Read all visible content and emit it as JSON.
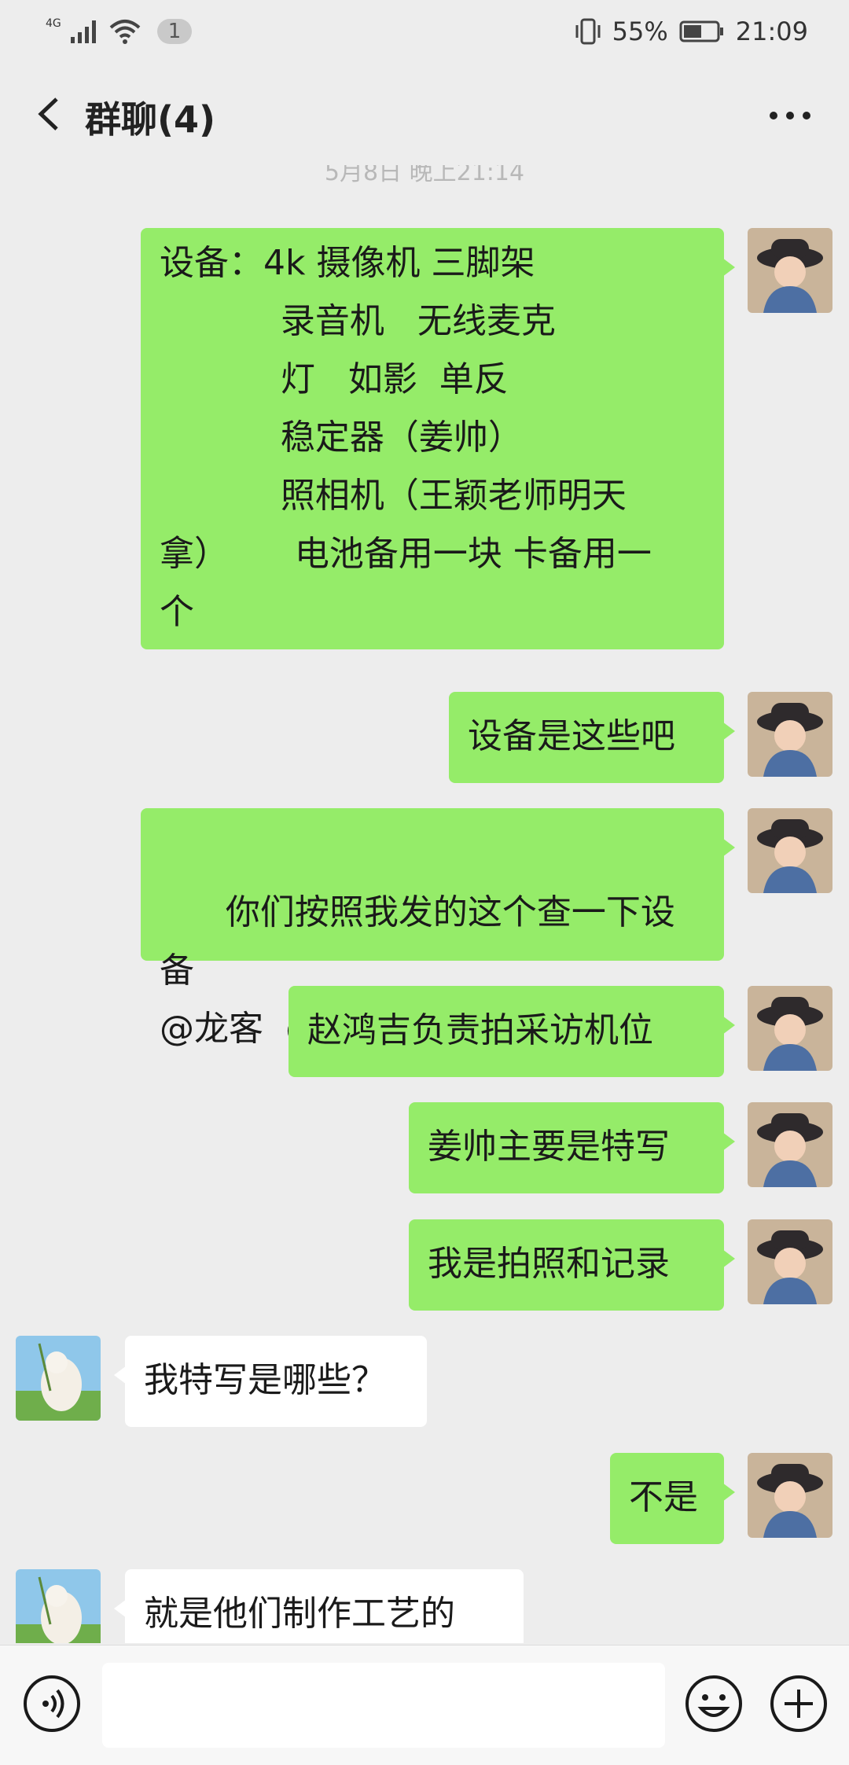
{
  "status_bar": {
    "network_label": "4G",
    "notification_count": "1",
    "battery_percent": "55%",
    "time": "21:09"
  },
  "header": {
    "title": "群聊(4)"
  },
  "chat": {
    "timestamp": "5月8日 晚上21:14",
    "messages": [
      {
        "sender": "me",
        "text": "设备：4k 摄像机 三脚架\n           录音机   无线麦克\n           灯   如影  单反\n           稳定器（姜帅）\n           照相机（王颖老师明天\n拿）      电池备用一块 卡备用一\n个"
      },
      {
        "sender": "me",
        "text": "设备是这些吧"
      },
      {
        "sender": "me",
        "text": "你们按照我发的这个查一下设备\n@龙客  @变白 ING 的蟹.阿金",
        "emoji": "🍤"
      },
      {
        "sender": "me",
        "text": "赵鸿吉负责拍采访机位"
      },
      {
        "sender": "me",
        "text": "姜帅主要是特写"
      },
      {
        "sender": "me",
        "text": "我是拍照和记录"
      },
      {
        "sender": "other",
        "text": "我特写是哪些？"
      },
      {
        "sender": "me",
        "text": "不是"
      },
      {
        "sender": "other",
        "text": "就是他们制作工艺的"
      }
    ]
  },
  "input_bar": {
    "placeholder": ""
  }
}
